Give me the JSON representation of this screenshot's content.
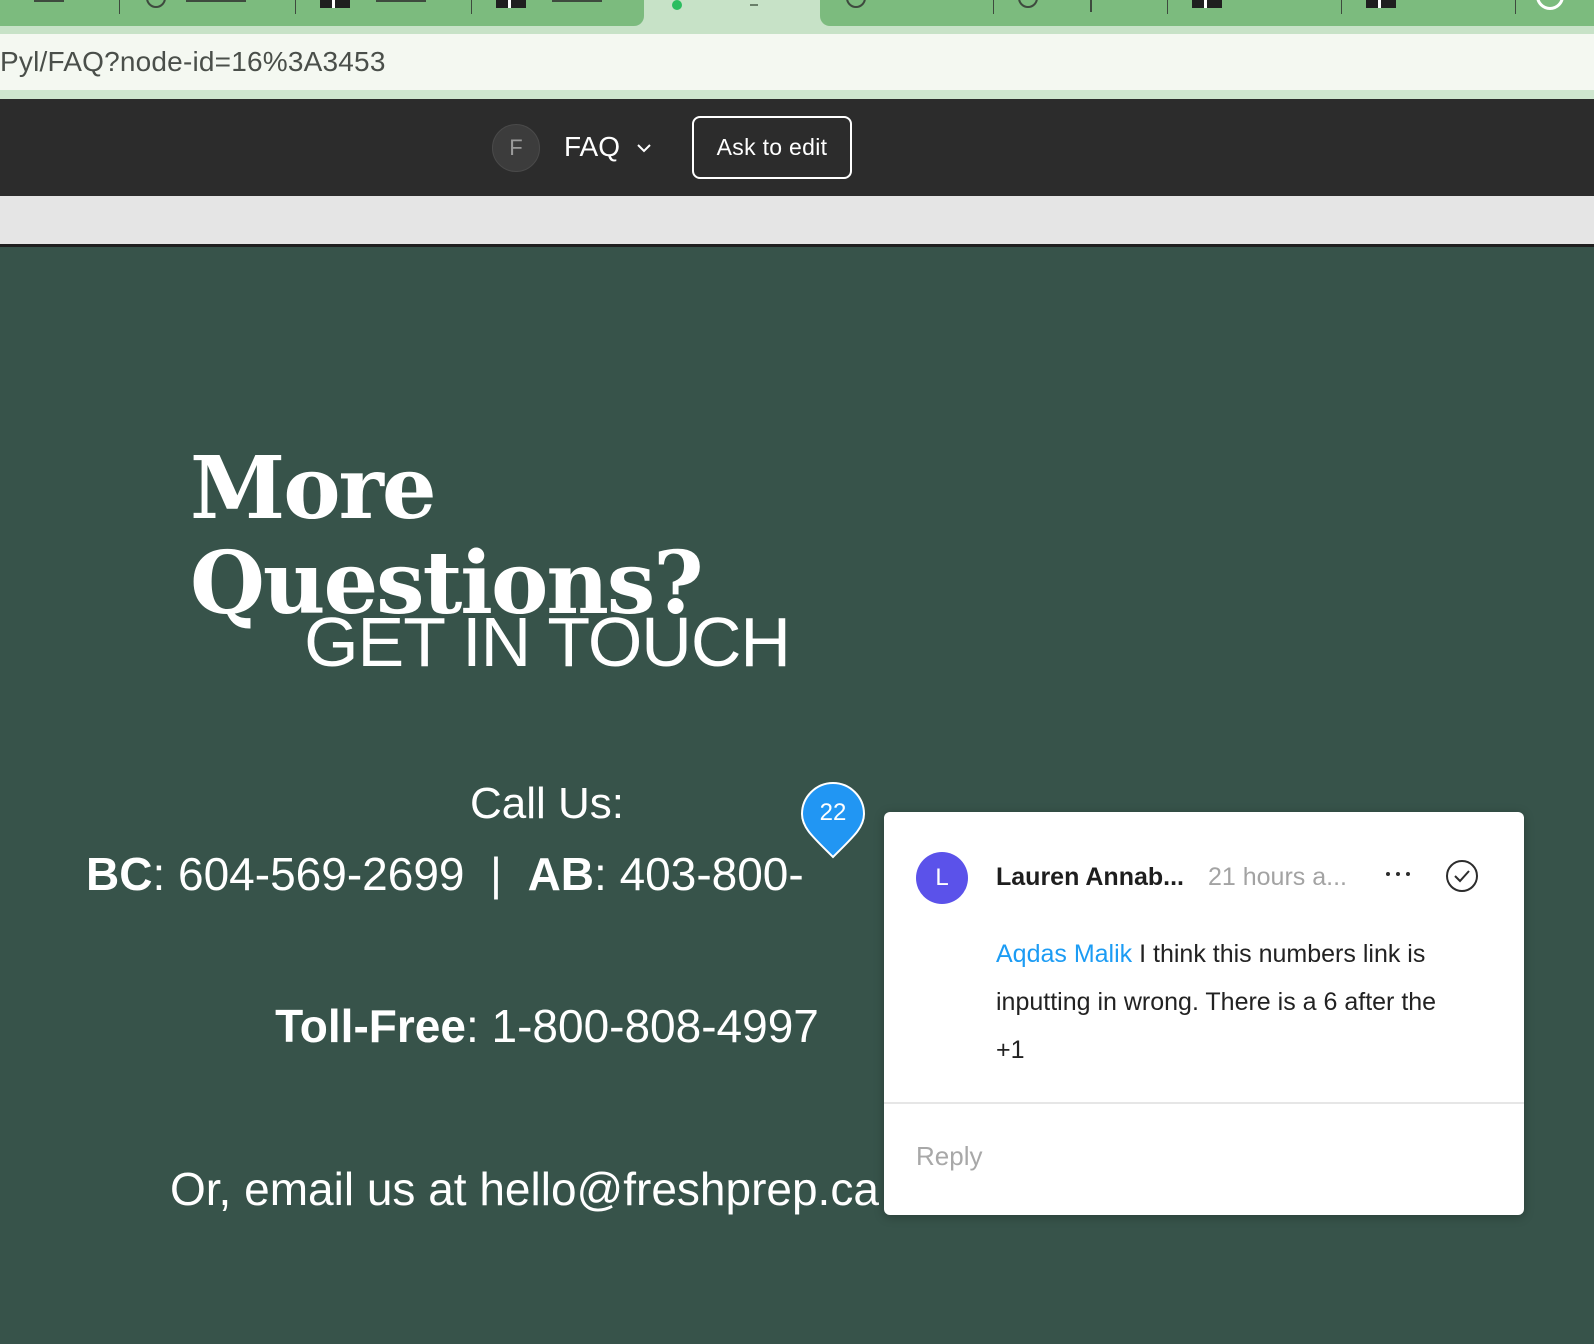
{
  "browser": {
    "url_text": "Pyl/FAQ?node-id=16%3A3453",
    "colors": {
      "tabstrip": "#c7e2c7",
      "tab_group": "#7cbb7e",
      "address_bg": "#f4f8f1"
    }
  },
  "toolbar": {
    "file_avatar_initial": "F",
    "file_name": "FAQ",
    "ask_to_edit_label": "Ask to edit"
  },
  "frame": {
    "background": "#37534a",
    "headline": "More Questions?",
    "subhead": "GET IN TOUCH",
    "call_us": "Call Us:",
    "bc_label": "BC",
    "bc_number": "604-569-2699",
    "separator": "|",
    "ab_label": "AB",
    "ab_number": "403-800-",
    "tollfree_label": "Toll-Free",
    "tollfree_number": "1-800-808-4997",
    "email_text": "Or, email us at hello@freshprep.ca"
  },
  "comment_pin": {
    "number": "22",
    "color": "#2196f3"
  },
  "comment": {
    "avatar_initial": "L",
    "avatar_color": "#5b52ea",
    "author": "Lauren Annab...",
    "timestamp": "21 hours a...",
    "mention": "Aqdas Malik",
    "body": "I think this numbers link is inputting in wrong. There is a 6 after the +1",
    "reply_placeholder": "Reply"
  }
}
